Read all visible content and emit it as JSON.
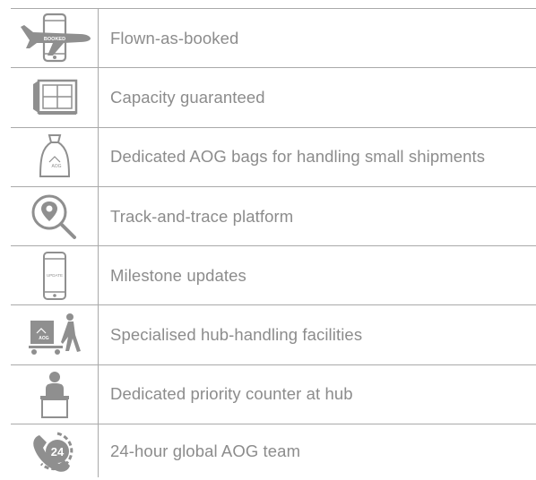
{
  "rows": [
    {
      "icon": "plane-phone-icon",
      "label": "Flown-as-booked",
      "icon_text": "BOOKED"
    },
    {
      "icon": "capacity-container-icon",
      "label": "Capacity guaranteed"
    },
    {
      "icon": "aog-bag-icon",
      "label": "Dedicated AOG bags for handling small shipments",
      "icon_text": "AOG"
    },
    {
      "icon": "location-search-icon",
      "label": "Track-and-trace platform"
    },
    {
      "icon": "phone-update-icon",
      "label": "Milestone updates",
      "icon_text": "UPDATE"
    },
    {
      "icon": "hub-handling-icon",
      "label": "Specialised hub-handling facilities",
      "icon_text": "AOG"
    },
    {
      "icon": "priority-counter-icon",
      "label": "Dedicated priority counter at hub"
    },
    {
      "icon": "24-hour-phone-icon",
      "label": "24-hour global AOG team",
      "icon_text": "24"
    }
  ],
  "colors": {
    "icon_gray": "#8f8f8f",
    "text_gray": "#8c8c8c",
    "border": "#a9a9a9"
  }
}
